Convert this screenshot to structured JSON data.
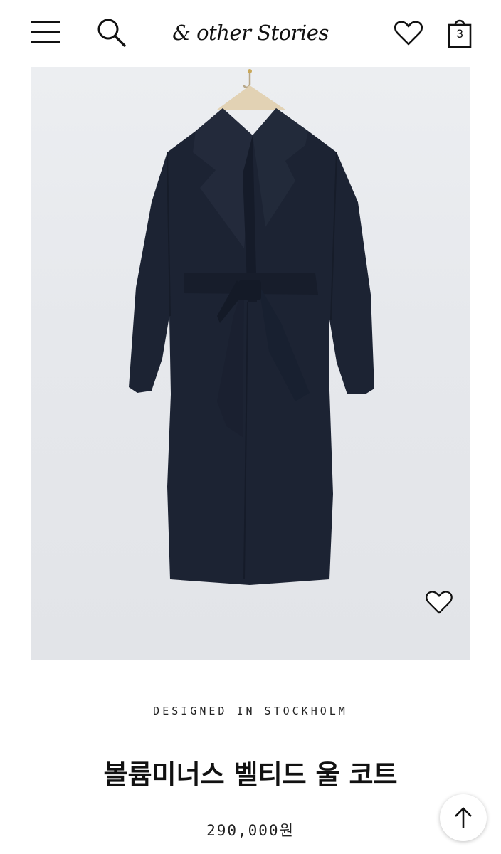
{
  "header": {
    "menu_icon": "hamburger-menu-icon",
    "search_icon": "search-icon",
    "logo": "& other Stories",
    "wishlist_icon": "heart-icon",
    "bag_icon": "shopping-bag-icon",
    "bag_count": "3"
  },
  "product": {
    "image_subject": "coat-image",
    "image_wishlist_icon": "heart-icon",
    "tagline": "DESIGNED IN STOCKHOLM",
    "name": "볼륨미너스 벨티드 울 코트",
    "price": "290,000원"
  },
  "scroll_top_icon": "arrow-up-icon",
  "colors": {
    "coat": "#1c2333",
    "background": "#e8eaee"
  }
}
